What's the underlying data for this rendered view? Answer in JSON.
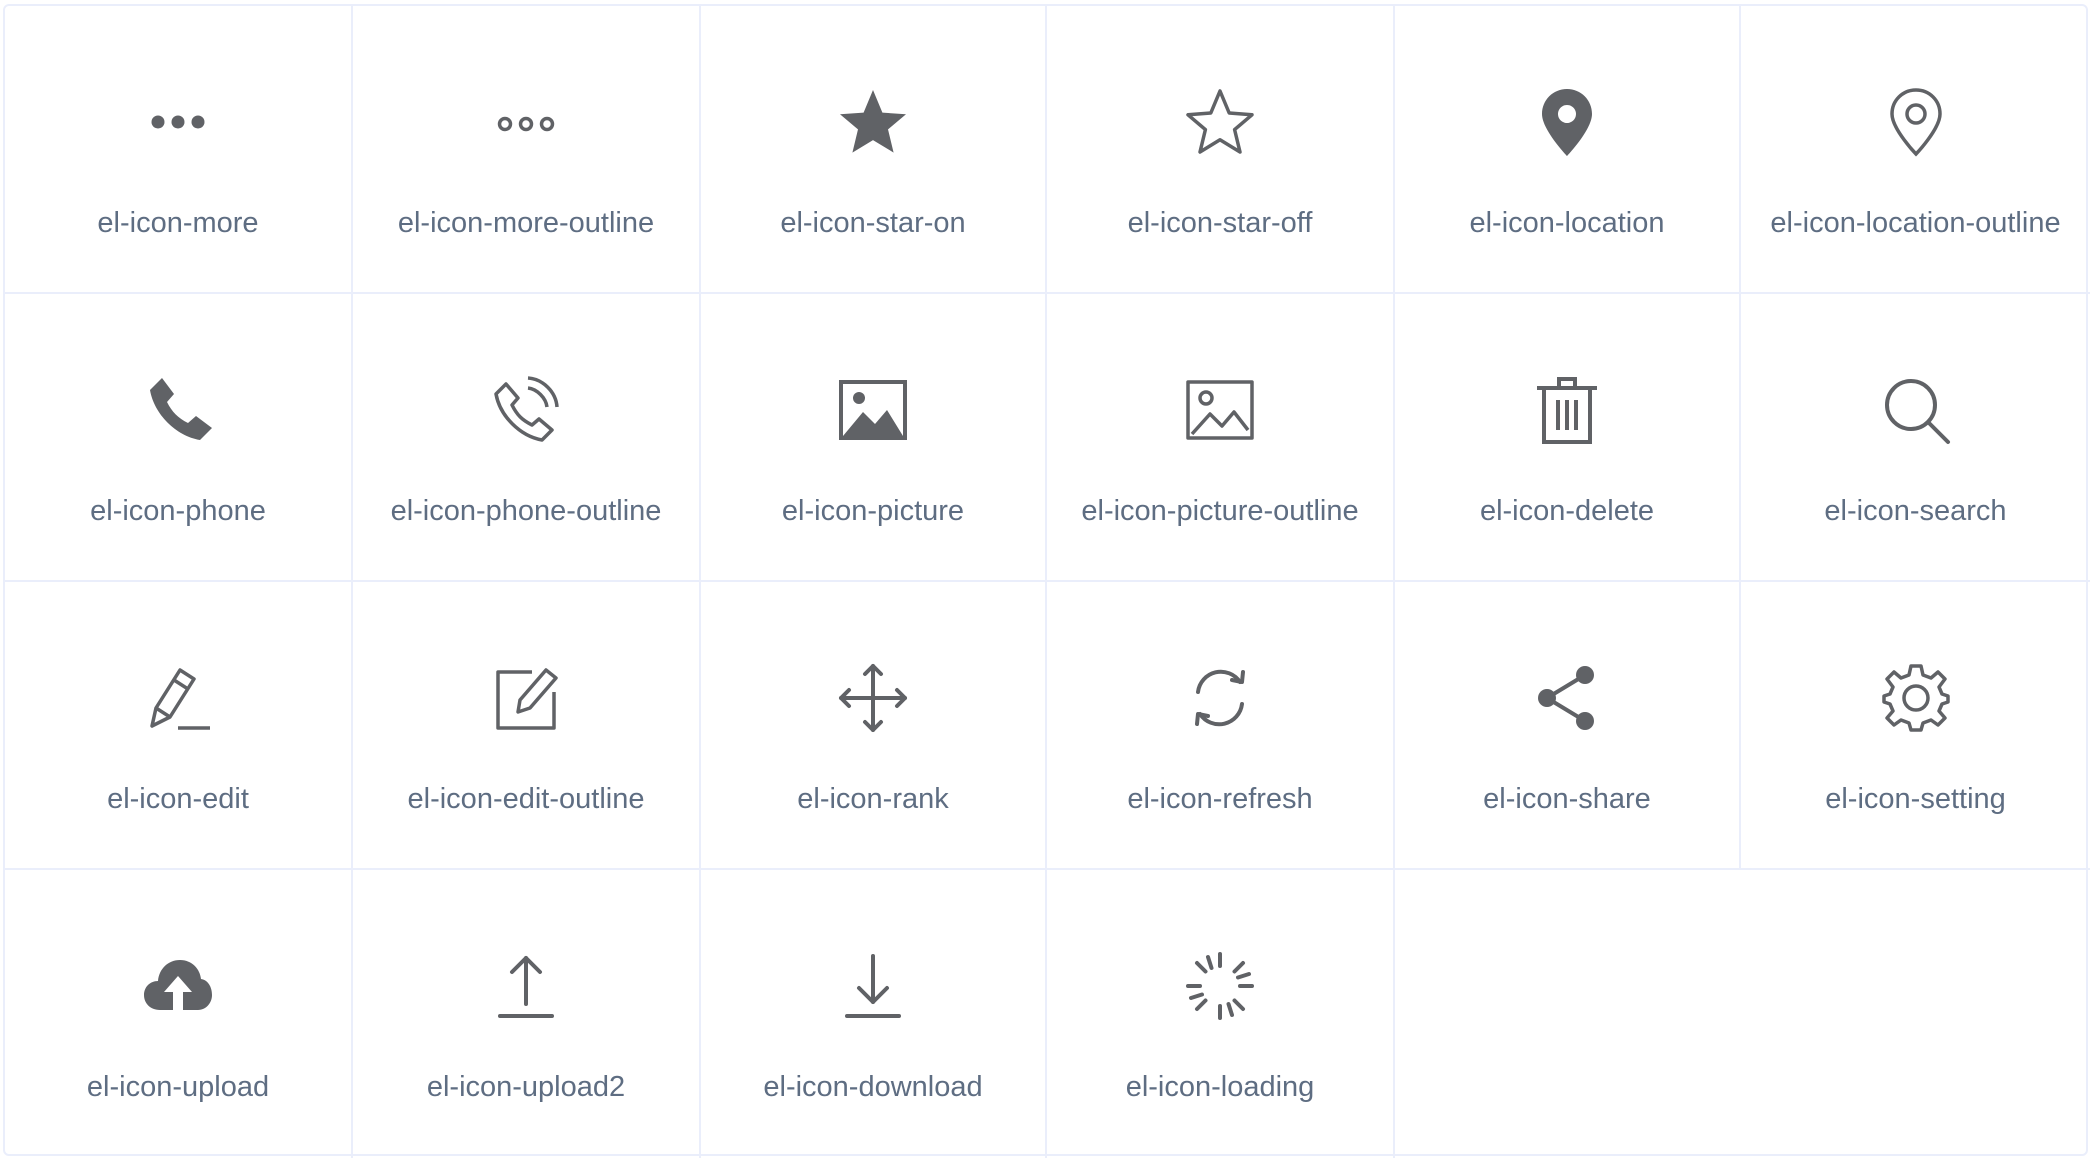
{
  "icons": [
    {
      "label": "el-icon-more",
      "icon": "more-icon"
    },
    {
      "label": "el-icon-more-outline",
      "icon": "more-outline-icon"
    },
    {
      "label": "el-icon-star-on",
      "icon": "star-on-icon"
    },
    {
      "label": "el-icon-star-off",
      "icon": "star-off-icon"
    },
    {
      "label": "el-icon-location",
      "icon": "location-icon"
    },
    {
      "label": "el-icon-location-outline",
      "icon": "location-outline-icon"
    },
    {
      "label": "el-icon-phone",
      "icon": "phone-icon"
    },
    {
      "label": "el-icon-phone-outline",
      "icon": "phone-outline-icon"
    },
    {
      "label": "el-icon-picture",
      "icon": "picture-icon"
    },
    {
      "label": "el-icon-picture-outline",
      "icon": "picture-outline-icon"
    },
    {
      "label": "el-icon-delete",
      "icon": "delete-icon"
    },
    {
      "label": "el-icon-search",
      "icon": "search-icon"
    },
    {
      "label": "el-icon-edit",
      "icon": "edit-icon"
    },
    {
      "label": "el-icon-edit-outline",
      "icon": "edit-outline-icon"
    },
    {
      "label": "el-icon-rank",
      "icon": "rank-icon"
    },
    {
      "label": "el-icon-refresh",
      "icon": "refresh-icon"
    },
    {
      "label": "el-icon-share",
      "icon": "share-icon"
    },
    {
      "label": "el-icon-setting",
      "icon": "setting-icon"
    },
    {
      "label": "el-icon-upload",
      "icon": "upload-icon"
    },
    {
      "label": "el-icon-upload2",
      "icon": "upload2-icon"
    },
    {
      "label": "el-icon-download",
      "icon": "download-icon"
    },
    {
      "label": "el-icon-loading",
      "icon": "loading-icon"
    }
  ],
  "colors": {
    "icon": "#606266",
    "label": "#5e6d82",
    "border": "#eaeefb"
  }
}
